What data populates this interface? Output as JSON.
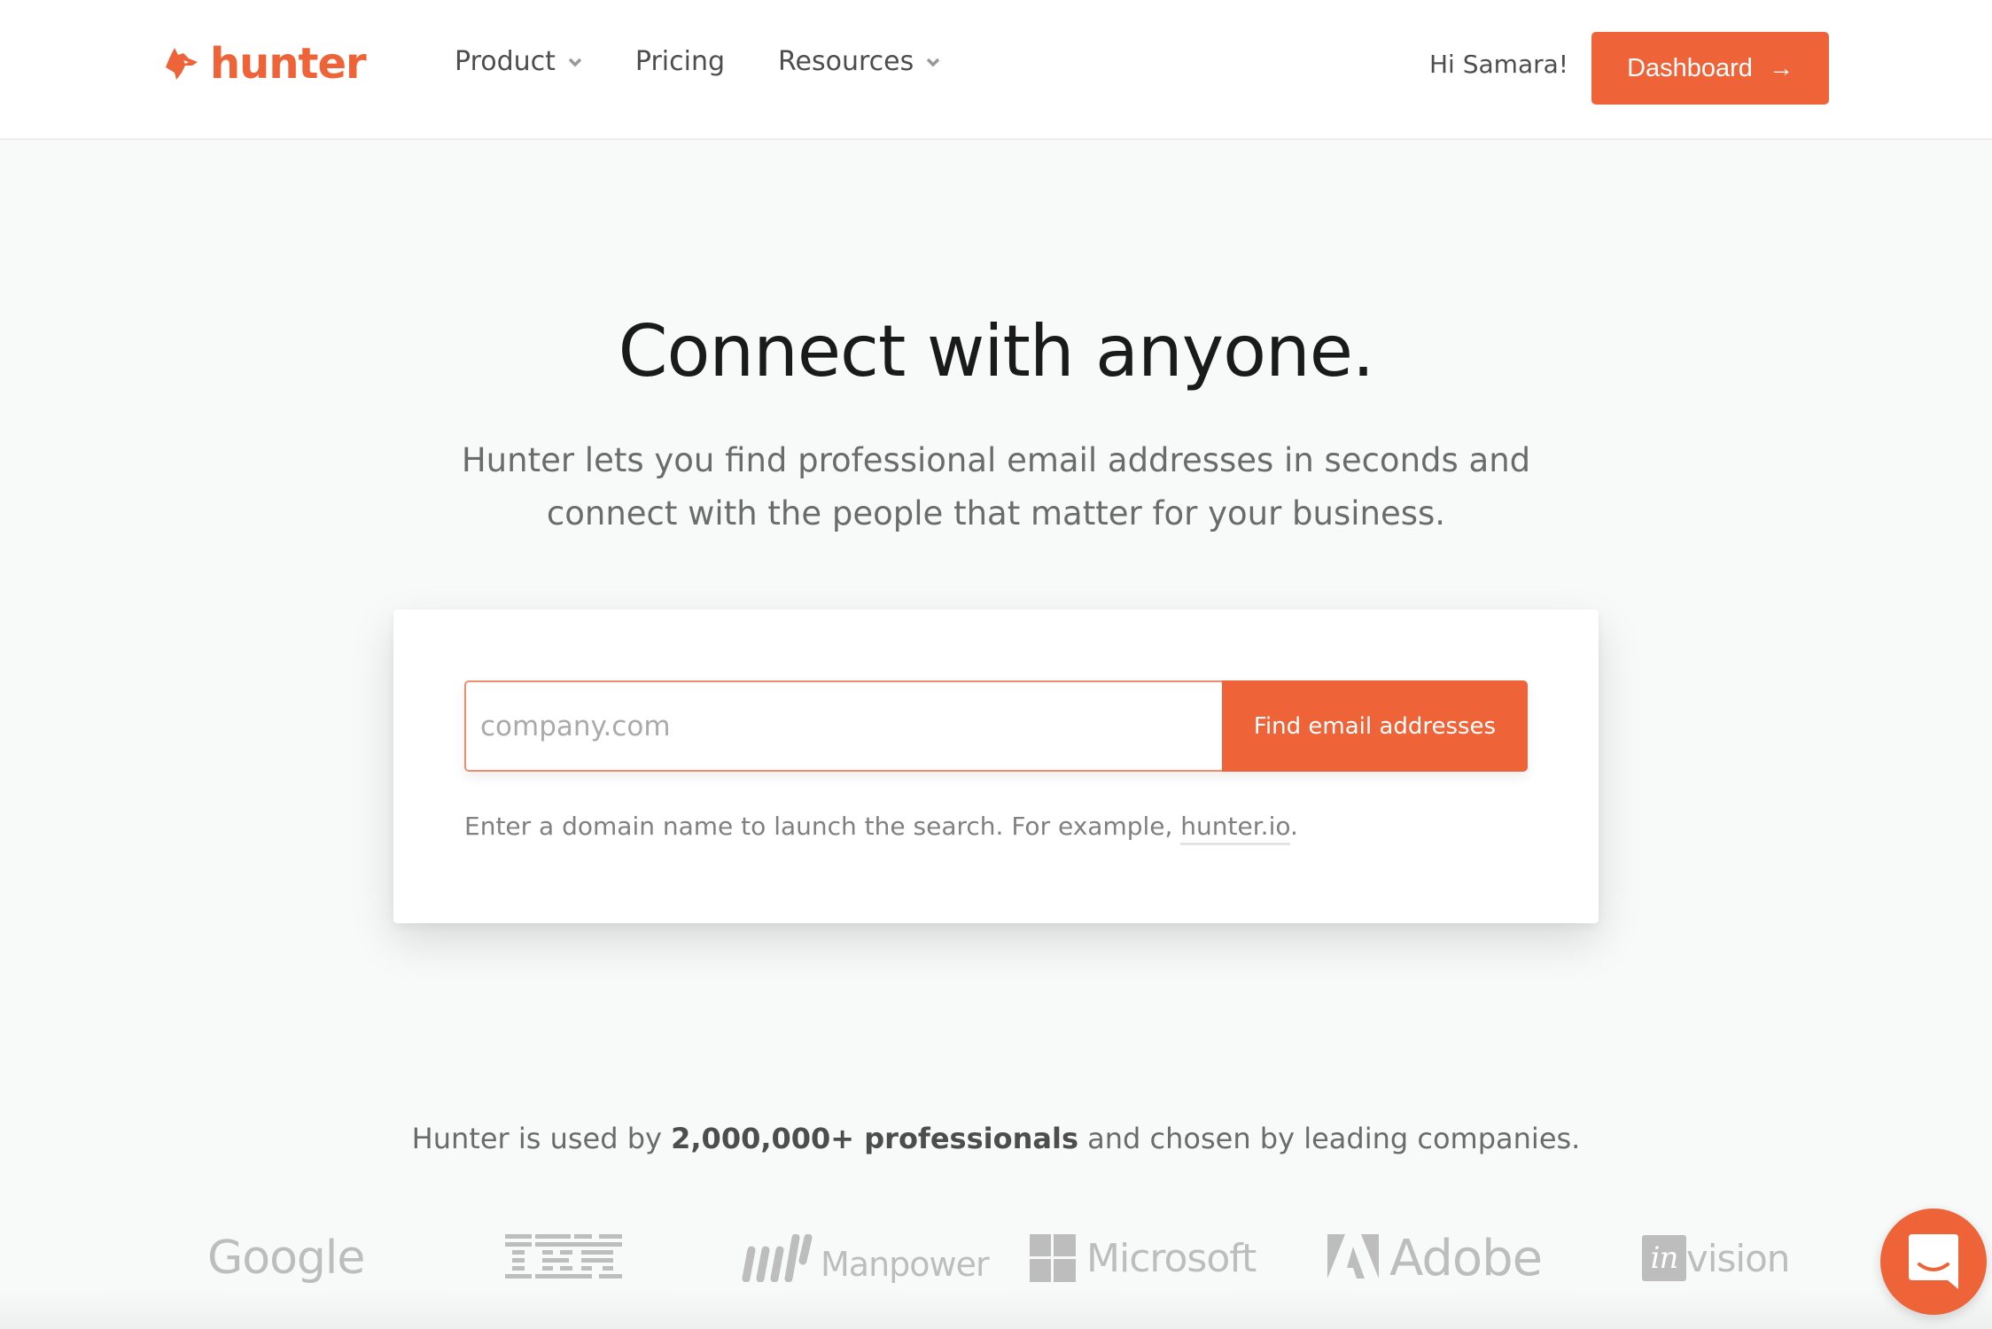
{
  "nav": {
    "brand": "hunter",
    "links": [
      {
        "label": "Product",
        "has_dropdown": true
      },
      {
        "label": "Pricing",
        "has_dropdown": false
      },
      {
        "label": "Resources",
        "has_dropdown": true
      }
    ],
    "greeting": "Hi Samara!",
    "dashboard_label": "Dashboard",
    "dashboard_arrow": "→"
  },
  "hero": {
    "title": "Connect with anyone.",
    "subtitle_line1": "Hunter lets you find professional email addresses in seconds and",
    "subtitle_line2": "connect with the people that matter for your business."
  },
  "search": {
    "placeholder": "company.com",
    "value": "",
    "button_label": "Find email addresses",
    "hint_prefix": "Enter a domain name to launch the search. For example, ",
    "hint_link": "hunter.io",
    "hint_suffix": "."
  },
  "trust": {
    "prefix": "Hunter is used by ",
    "highlight": "2,000,000+ professionals",
    "suffix": " and chosen by leading companies."
  },
  "companies": [
    "Google",
    "IBM",
    "Manpower",
    "Microsoft",
    "Adobe",
    "invision"
  ],
  "colors": {
    "accent": "#ee6337",
    "logo_gray": "#bdbdbd",
    "background": "#f8f9f9"
  },
  "chat": {
    "icon": "chat-icon"
  }
}
